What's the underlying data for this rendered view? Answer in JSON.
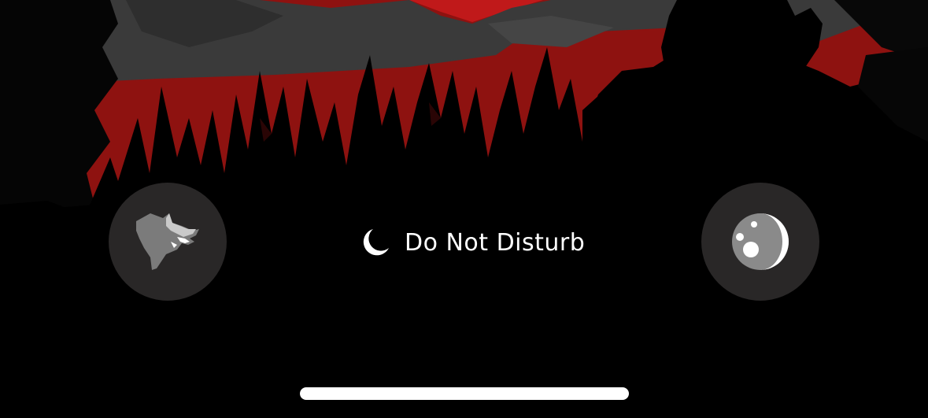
{
  "lock_screen": {
    "focus_mode": {
      "label": "Do Not Disturb",
      "icon": "moon-icon"
    },
    "left_shortcut": {
      "icon": "wolf-head-icon"
    },
    "right_shortcut": {
      "icon": "moon-crescent-icon"
    },
    "wallpaper": {
      "description_icon": "wallpaper-image",
      "colors": {
        "sky_red": "#8e1210",
        "mountain_gray": "#3a3a3a",
        "silhouette": "#000000"
      }
    }
  }
}
